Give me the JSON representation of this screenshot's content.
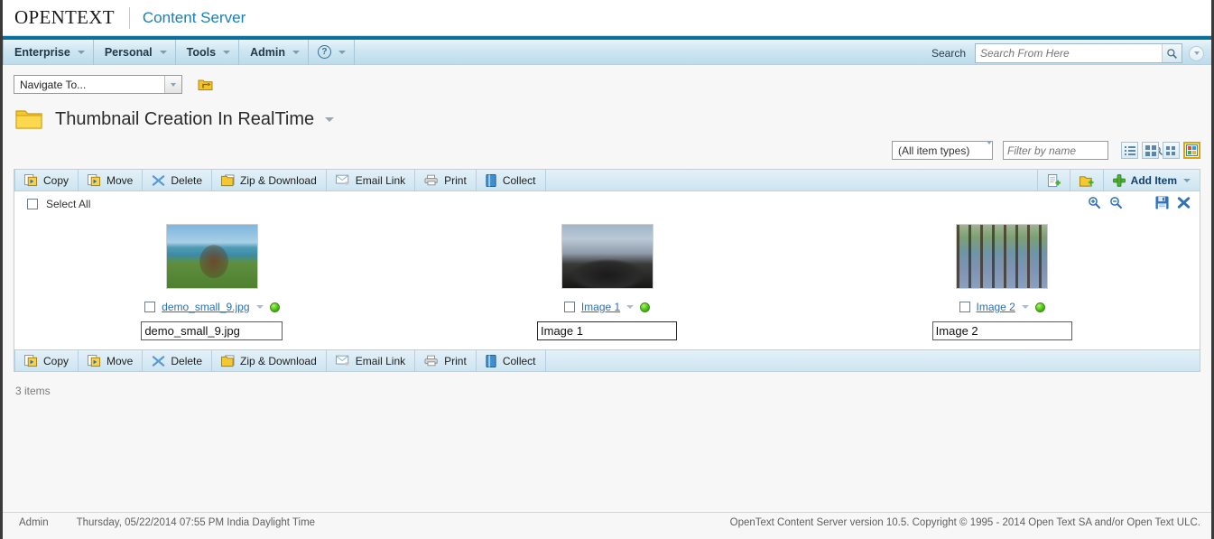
{
  "brand": {
    "company": "OPENTEXT",
    "product": "Content Server"
  },
  "menu": {
    "items": [
      {
        "label": "Enterprise"
      },
      {
        "label": "Personal"
      },
      {
        "label": "Tools"
      },
      {
        "label": "Admin"
      }
    ],
    "help_glyph": "?",
    "search_label": "Search",
    "search_value": "",
    "search_placeholder": "Search From Here"
  },
  "navigate": {
    "combo_value": "Navigate To...",
    "up_folder_title": "Up one level"
  },
  "page_title": {
    "text": "Thumbnail Creation In RealTime"
  },
  "filters": {
    "type_value": "(All item types)",
    "filter_value": "",
    "filter_placeholder": "Filter by name",
    "views": [
      {
        "name": "view-list",
        "active": false
      },
      {
        "name": "view-large-tiles",
        "active": false
      },
      {
        "name": "view-small-tiles",
        "active": false
      },
      {
        "name": "view-thumbnails",
        "active": true
      }
    ]
  },
  "toolbar": {
    "commands": [
      {
        "label": "Copy",
        "icon": "copy-icon"
      },
      {
        "label": "Move",
        "icon": "move-icon"
      },
      {
        "label": "Delete",
        "icon": "delete-icon"
      },
      {
        "label": "Zip & Download",
        "icon": "zip-download-icon"
      },
      {
        "label": "Email Link",
        "icon": "email-link-icon"
      },
      {
        "label": "Print",
        "icon": "print-icon"
      },
      {
        "label": "Collect",
        "icon": "collect-icon"
      }
    ],
    "add_item_label": "Add Item",
    "new_doc_title": "New Document",
    "new_folder_title": "New Folder"
  },
  "select_row": {
    "select_all_label": "Select All",
    "zoom_in_title": "Zoom In",
    "zoom_out_title": "Zoom Out",
    "save_title": "Save",
    "cancel_title": "Cancel"
  },
  "items": [
    {
      "name": "demo_small_9.jpg",
      "edit_value": "demo_small_9.jpg",
      "art": "img-church",
      "focused": false,
      "input_width": 157,
      "status": "available"
    },
    {
      "name": "Image 1",
      "edit_value": "Image 1",
      "art": "img-rock",
      "focused": true,
      "input_width": 155,
      "status": "available"
    },
    {
      "name": "Image 2",
      "edit_value": "Image 2",
      "art": "img-forest",
      "focused": false,
      "input_width": 155,
      "status": "available"
    }
  ],
  "items_count": "3 items",
  "footer": {
    "user": "Admin",
    "timestamp": "Thursday, 05/22/2014 07:55 PM India Daylight Time",
    "copyright": "OpenText Content Server version 10.5. Copyright © 1995 - 2014 Open Text SA and/or Open Text ULC."
  },
  "colors": {
    "brand_blue": "#1b7fb5",
    "menu_top_border": "#0b6f9d",
    "link_blue": "#2a6ebb",
    "status_green": "#49c014",
    "active_view_border": "#e8a200"
  }
}
